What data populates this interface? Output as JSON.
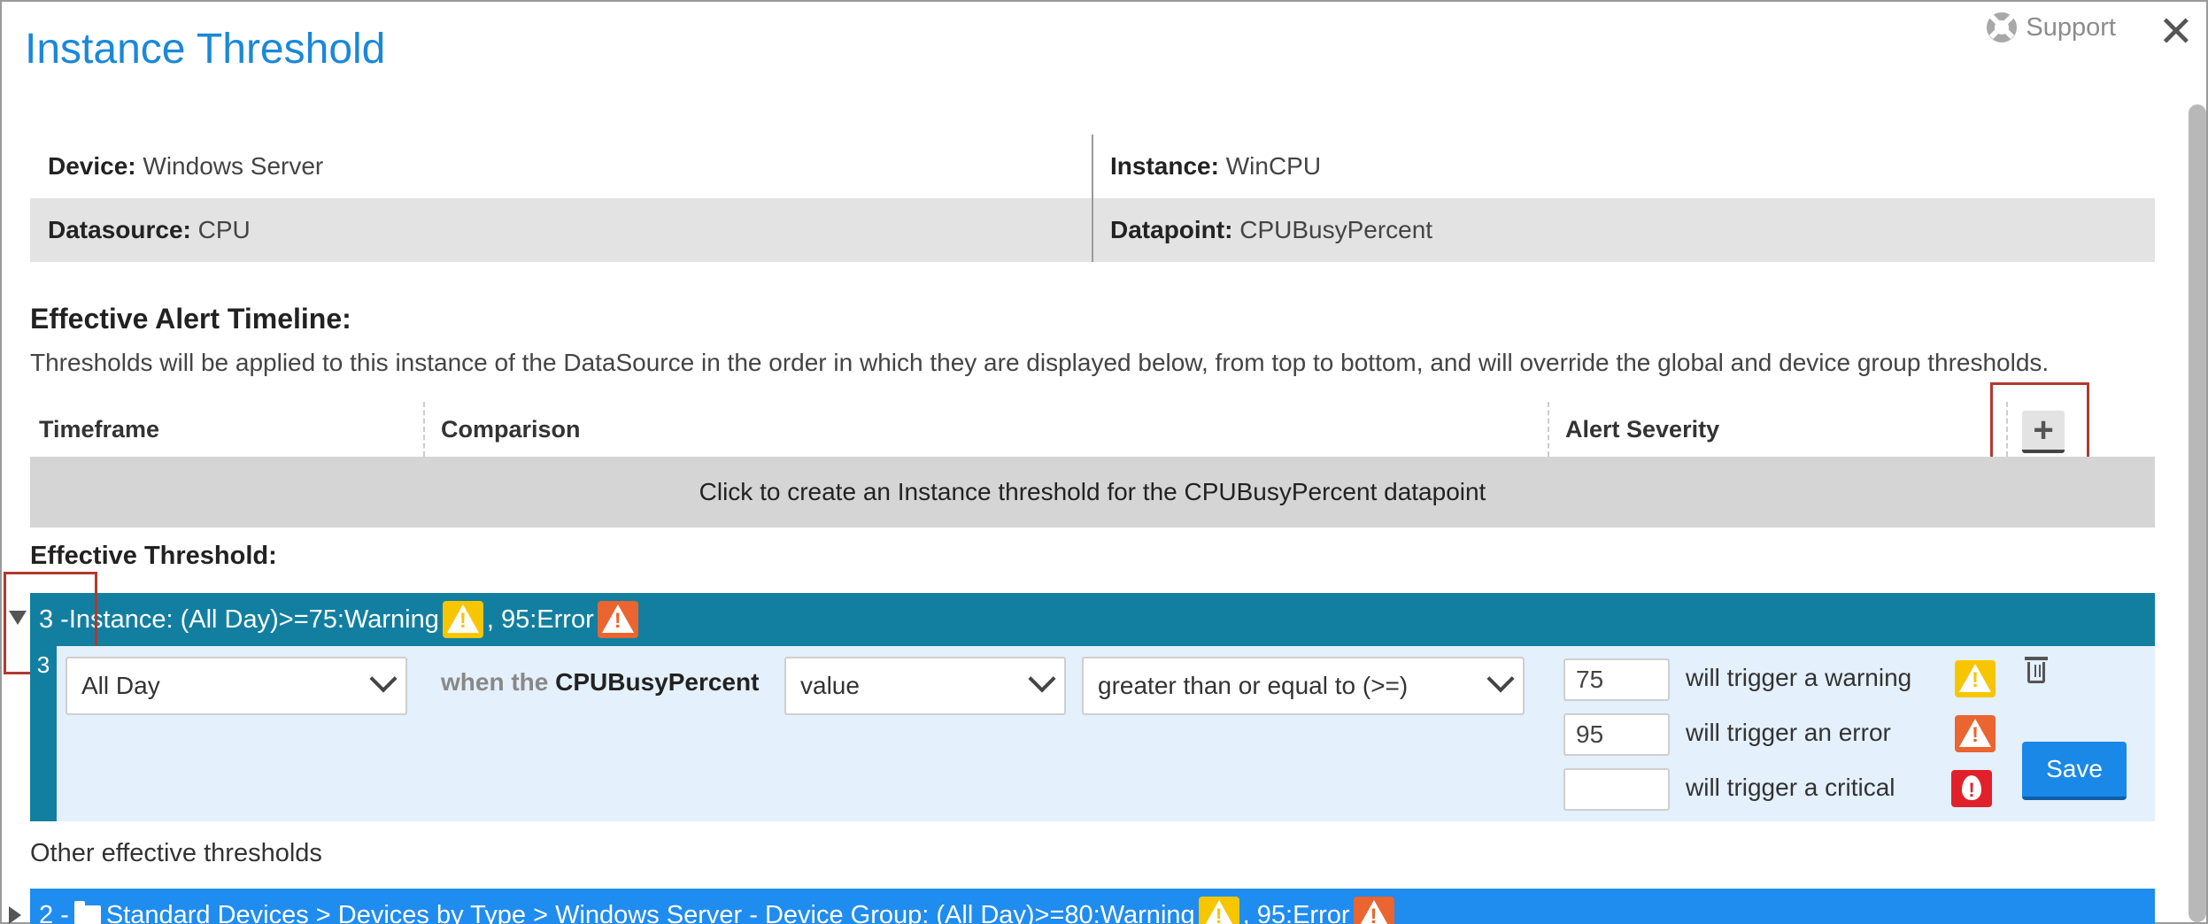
{
  "window": {
    "title": "Instance Threshold",
    "support_label": "Support",
    "close_symbol": "✕"
  },
  "info": {
    "device_label": "Device:",
    "device_value": "Windows Server",
    "instance_label": "Instance:",
    "instance_value": "WinCPU",
    "datasource_label": "Datasource:",
    "datasource_value": "CPU",
    "datapoint_label": "Datapoint:",
    "datapoint_value": "CPUBusyPercent"
  },
  "timeline": {
    "heading": "Effective Alert Timeline:",
    "description": "Thresholds will be applied to this instance of the DataSource in the order in which they are displayed below, from top to bottom, and will override the global and device group thresholds.",
    "columns": [
      "Timeframe",
      "Comparison",
      "Alert Severity"
    ],
    "add_symbol": "+",
    "create_text": "Click to create an Instance threshold for the CPUBusyPercent datapoint"
  },
  "effective": {
    "label": "Effective Threshold:",
    "bar_text_a": "3 -Instance: (All Day)>=75:Warning",
    "bar_text_b": ", 95:Error",
    "rail_number": "3",
    "timeframe": "All Day",
    "when_prefix": "when the",
    "when_datapoint": "CPUBusyPercent",
    "value_select": "value",
    "operator_select": "greater than or equal to (>=)",
    "warning_value": "75",
    "error_value": "95",
    "critical_value": "",
    "warning_text": "will trigger a warning",
    "error_text": "will trigger an error",
    "critical_text": "will trigger a critical",
    "save_label": "Save"
  },
  "other": {
    "label": "Other effective thresholds",
    "bar_prefix": "2 -",
    "bar_text_a": "Standard Devices > Devices by Type > Windows Server - Device Group: (All Day)>=80:Warning",
    "bar_text_b": ", 95:Error"
  },
  "colors": {
    "accent": "#1a88d8",
    "effective_bar": "#137fa0",
    "group_bar": "#1f8cf0",
    "warning": "#f7c600",
    "error": "#ea6530",
    "critical": "#e0212b",
    "highlight": "#b03a2e"
  },
  "icons": [
    "support-lifebuoy-icon",
    "close-icon",
    "add-plus-icon",
    "collapse-caret-icon",
    "warning-icon",
    "error-icon",
    "critical-icon",
    "trash-icon",
    "expand-caret-icon",
    "folder-icon"
  ]
}
